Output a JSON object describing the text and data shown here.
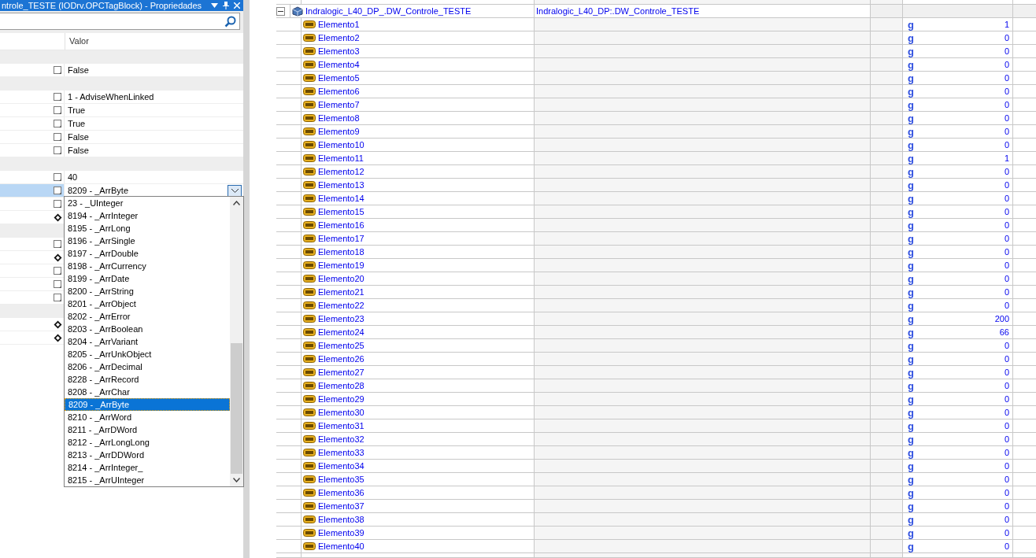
{
  "properties_panel": {
    "title": "ntrole_TESTE (IODrv.OPCTagBlock) - Propriedades",
    "column_header": "Valor",
    "rows": [
      {
        "kind": "category"
      },
      {
        "kind": "editable",
        "value": "False",
        "selected": false
      },
      {
        "kind": "category"
      },
      {
        "kind": "editable",
        "value": "1 - AdviseWhenLinked",
        "selected": false
      },
      {
        "kind": "editable",
        "value": "True",
        "selected": false
      },
      {
        "kind": "editable",
        "value": "True",
        "selected": false
      },
      {
        "kind": "editable",
        "value": "False",
        "selected": false
      },
      {
        "kind": "editable",
        "value": "False",
        "selected": false
      },
      {
        "kind": "category"
      },
      {
        "kind": "editable",
        "value": "40",
        "selected": false
      },
      {
        "kind": "editable",
        "value": "8209 - _ArrByte",
        "selected": true
      },
      {
        "kind": "editable",
        "selected": false
      },
      {
        "kind": "linked",
        "selected": false
      },
      {
        "kind": "category"
      },
      {
        "kind": "editable",
        "selected": false
      },
      {
        "kind": "linked",
        "selected": false
      },
      {
        "kind": "editable",
        "selected": false
      },
      {
        "kind": "editable",
        "selected": false
      },
      {
        "kind": "editable",
        "selected": false
      },
      {
        "kind": "category"
      },
      {
        "kind": "linked",
        "selected": false
      },
      {
        "kind": "linked",
        "selected": false
      }
    ],
    "dropdown": {
      "items": [
        {
          "label": "23 - _UInteger",
          "selected": false
        },
        {
          "label": "8194 - _ArrInteger",
          "selected": false
        },
        {
          "label": "8195 - _ArrLong",
          "selected": false
        },
        {
          "label": "8196 - _ArrSingle",
          "selected": false
        },
        {
          "label": "8197 - _ArrDouble",
          "selected": false
        },
        {
          "label": "8198 - _ArrCurrency",
          "selected": false
        },
        {
          "label": "8199 - _ArrDate",
          "selected": false
        },
        {
          "label": "8200 - _ArrString",
          "selected": false
        },
        {
          "label": "8201 - _ArrObject",
          "selected": false
        },
        {
          "label": "8202 - _ArrError",
          "selected": false
        },
        {
          "label": "8203 - _ArrBoolean",
          "selected": false
        },
        {
          "label": "8204 - _ArrVariant",
          "selected": false
        },
        {
          "label": "8205 - _ArrUnkObject",
          "selected": false
        },
        {
          "label": "8206 - _ArrDecimal",
          "selected": false
        },
        {
          "label": "8228 - _ArrRecord",
          "selected": false
        },
        {
          "label": "8208 - _ArrChar",
          "selected": false
        },
        {
          "label": "8209 - _ArrByte",
          "selected": true
        },
        {
          "label": "8210 - _ArrWord",
          "selected": false
        },
        {
          "label": "8211 - _ArrDWord",
          "selected": false
        },
        {
          "label": "8212 - _ArrLongLong",
          "selected": false
        },
        {
          "label": "8213 - _ArrDDWord",
          "selected": false
        },
        {
          "label": "8214 - _ArrInteger_",
          "selected": false
        },
        {
          "label": "8215 - _ArrUInteger",
          "selected": false
        }
      ]
    }
  },
  "tag_tree": {
    "group": {
      "name": "Indralogic_L40_DP_.DW_Controle_TESTE",
      "description": "Indralogic_L40_DP:.DW_Controle_TESTE",
      "expanded": true
    },
    "elements": [
      {
        "name": "Elemento1",
        "type_glyph": "g",
        "value": "1"
      },
      {
        "name": "Elemento2",
        "type_glyph": "g",
        "value": "0"
      },
      {
        "name": "Elemento3",
        "type_glyph": "g",
        "value": "0"
      },
      {
        "name": "Elemento4",
        "type_glyph": "g",
        "value": "0"
      },
      {
        "name": "Elemento5",
        "type_glyph": "g",
        "value": "0"
      },
      {
        "name": "Elemento6",
        "type_glyph": "g",
        "value": "0"
      },
      {
        "name": "Elemento7",
        "type_glyph": "g",
        "value": "0"
      },
      {
        "name": "Elemento8",
        "type_glyph": "g",
        "value": "0"
      },
      {
        "name": "Elemento9",
        "type_glyph": "g",
        "value": "0"
      },
      {
        "name": "Elemento10",
        "type_glyph": "g",
        "value": "0"
      },
      {
        "name": "Elemento11",
        "type_glyph": "g",
        "value": "1"
      },
      {
        "name": "Elemento12",
        "type_glyph": "g",
        "value": "0"
      },
      {
        "name": "Elemento13",
        "type_glyph": "g",
        "value": "0"
      },
      {
        "name": "Elemento14",
        "type_glyph": "g",
        "value": "0"
      },
      {
        "name": "Elemento15",
        "type_glyph": "g",
        "value": "0"
      },
      {
        "name": "Elemento16",
        "type_glyph": "g",
        "value": "0"
      },
      {
        "name": "Elemento17",
        "type_glyph": "g",
        "value": "0"
      },
      {
        "name": "Elemento18",
        "type_glyph": "g",
        "value": "0"
      },
      {
        "name": "Elemento19",
        "type_glyph": "g",
        "value": "0"
      },
      {
        "name": "Elemento20",
        "type_glyph": "g",
        "value": "0"
      },
      {
        "name": "Elemento21",
        "type_glyph": "g",
        "value": "0"
      },
      {
        "name": "Elemento22",
        "type_glyph": "g",
        "value": "0"
      },
      {
        "name": "Elemento23",
        "type_glyph": "g",
        "value": "200"
      },
      {
        "name": "Elemento24",
        "type_glyph": "g",
        "value": "66"
      },
      {
        "name": "Elemento25",
        "type_glyph": "g",
        "value": "0"
      },
      {
        "name": "Elemento26",
        "type_glyph": "g",
        "value": "0"
      },
      {
        "name": "Elemento27",
        "type_glyph": "g",
        "value": "0"
      },
      {
        "name": "Elemento28",
        "type_glyph": "g",
        "value": "0"
      },
      {
        "name": "Elemento29",
        "type_glyph": "g",
        "value": "0"
      },
      {
        "name": "Elemento30",
        "type_glyph": "g",
        "value": "0"
      },
      {
        "name": "Elemento31",
        "type_glyph": "g",
        "value": "0"
      },
      {
        "name": "Elemento32",
        "type_glyph": "g",
        "value": "0"
      },
      {
        "name": "Elemento33",
        "type_glyph": "g",
        "value": "0"
      },
      {
        "name": "Elemento34",
        "type_glyph": "g",
        "value": "0"
      },
      {
        "name": "Elemento35",
        "type_glyph": "g",
        "value": "0"
      },
      {
        "name": "Elemento36",
        "type_glyph": "g",
        "value": "0"
      },
      {
        "name": "Elemento37",
        "type_glyph": "g",
        "value": "0"
      },
      {
        "name": "Elemento38",
        "type_glyph": "g",
        "value": "0"
      },
      {
        "name": "Elemento39",
        "type_glyph": "g",
        "value": "0"
      },
      {
        "name": "Elemento40",
        "type_glyph": "g",
        "value": "0"
      }
    ]
  }
}
